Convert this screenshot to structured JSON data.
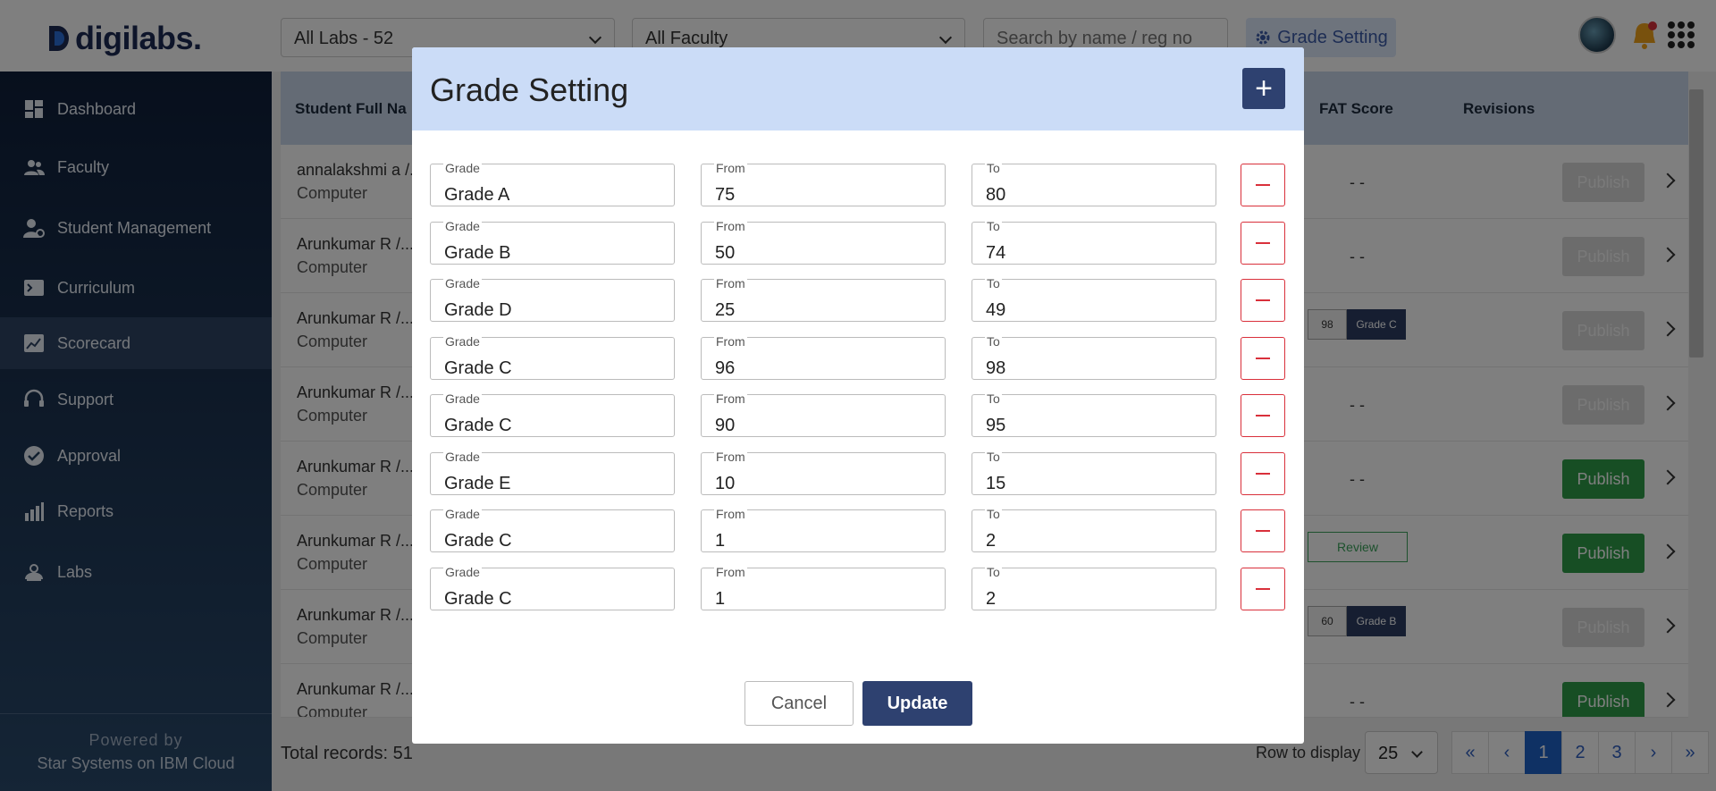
{
  "brand": {
    "name": "digilabs."
  },
  "topbar": {
    "labs_select": "All Labs - 52",
    "faculty_select": "All Faculty",
    "search_placeholder": "Search by name / reg no",
    "grade_setting_label": "Grade Setting"
  },
  "sidebar": {
    "items": [
      {
        "label": "Dashboard",
        "icon": "dashboard-icon"
      },
      {
        "label": "Faculty",
        "icon": "faculty-icon"
      },
      {
        "label": "Student Management",
        "icon": "student-management-icon"
      },
      {
        "label": "Curriculum",
        "icon": "curriculum-icon"
      },
      {
        "label": "Scorecard",
        "icon": "scorecard-icon",
        "active": true
      },
      {
        "label": "Support",
        "icon": "headset-icon"
      },
      {
        "label": "Approval",
        "icon": "check-circle-icon"
      },
      {
        "label": "Reports",
        "icon": "bar-chart-icon"
      },
      {
        "label": "Labs",
        "icon": "labs-icon"
      }
    ],
    "powered_by": "Powered by",
    "powered_company": "Star Systems on IBM Cloud"
  },
  "table": {
    "headers": {
      "student_name": "Student Full Na",
      "fat_score": "FAT Score",
      "revisions": "Revisions"
    },
    "rows": [
      {
        "name": "annalakshmi a /...",
        "dept": "Computer",
        "fat": "- -",
        "publish": "Publish",
        "published_enabled": false
      },
      {
        "name": "Arunkumar R /...",
        "dept": "Computer",
        "fat": "- -",
        "publish": "Publish",
        "published_enabled": false
      },
      {
        "name": "Arunkumar R /...",
        "dept": "Computer",
        "fat_score": "98",
        "fat_grade": "Grade C",
        "publish": "Publish",
        "published_enabled": false
      },
      {
        "name": "Arunkumar R /...",
        "dept": "Computer",
        "fat": "- -",
        "publish": "Publish",
        "published_enabled": false
      },
      {
        "name": "Arunkumar R /...",
        "dept": "Computer",
        "fat": "- -",
        "publish": "Publish",
        "published_enabled": true
      },
      {
        "name": "Arunkumar R /...",
        "dept": "Computer",
        "review": "Review",
        "publish": "Publish",
        "published_enabled": true
      },
      {
        "name": "Arunkumar R /...",
        "dept": "Computer",
        "fat_score": "60",
        "fat_grade": "Grade B",
        "publish": "Publish",
        "published_enabled": false
      },
      {
        "name": "Arunkumar R /...",
        "dept": "Computer",
        "fat": "- -",
        "publish": "Publish",
        "published_enabled": true
      }
    ]
  },
  "footer": {
    "total_records": "Total records: 51",
    "rows_label": "Row to display",
    "rows_value": "25",
    "pages": [
      "«",
      "‹",
      "1",
      "2",
      "3",
      "›",
      "»"
    ],
    "active_page": "1"
  },
  "modal": {
    "title": "Grade Setting",
    "add_label": "+",
    "field_labels": {
      "grade": "Grade",
      "from": "From",
      "to": "To"
    },
    "grades": [
      {
        "grade": "Grade A",
        "from": "75",
        "to": "80"
      },
      {
        "grade": "Grade B",
        "from": "50",
        "to": "74"
      },
      {
        "grade": "Grade D",
        "from": "25",
        "to": "49"
      },
      {
        "grade": "Grade C",
        "from": "96",
        "to": "98"
      },
      {
        "grade": "Grade C",
        "from": "90",
        "to": "95"
      },
      {
        "grade": "Grade E",
        "from": "10",
        "to": "15"
      },
      {
        "grade": "Grade C",
        "from": "1",
        "to": "2"
      },
      {
        "grade": "Grade C",
        "from": "1",
        "to": "2"
      }
    ],
    "cancel_label": "Cancel",
    "update_label": "Update"
  },
  "colors": {
    "primary": "#2e4170",
    "publish_green": "#2e9d48",
    "remove_red": "#d9303b",
    "modal_header": "#cbdcf7"
  }
}
